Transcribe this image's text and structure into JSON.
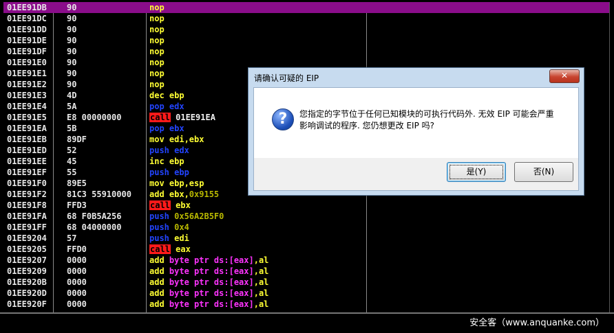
{
  "disassembly": {
    "rows": [
      {
        "addr": "01EE91DB",
        "hex": "90",
        "tokens": [
          {
            "t": "nop",
            "c": "yellow"
          }
        ],
        "selected": true
      },
      {
        "addr": "01EE91DC",
        "hex": "90",
        "tokens": [
          {
            "t": "nop",
            "c": "yellow"
          }
        ]
      },
      {
        "addr": "01EE91DD",
        "hex": "90",
        "tokens": [
          {
            "t": "nop",
            "c": "yellow"
          }
        ]
      },
      {
        "addr": "01EE91DE",
        "hex": "90",
        "tokens": [
          {
            "t": "nop",
            "c": "yellow"
          }
        ]
      },
      {
        "addr": "01EE91DF",
        "hex": "90",
        "tokens": [
          {
            "t": "nop",
            "c": "yellow"
          }
        ]
      },
      {
        "addr": "01EE91E0",
        "hex": "90",
        "tokens": [
          {
            "t": "nop",
            "c": "yellow"
          }
        ]
      },
      {
        "addr": "01EE91E1",
        "hex": "90",
        "tokens": [
          {
            "t": "nop",
            "c": "yellow"
          }
        ]
      },
      {
        "addr": "01EE91E2",
        "hex": "90",
        "tokens": [
          {
            "t": "nop",
            "c": "yellow"
          }
        ]
      },
      {
        "addr": "01EE91E3",
        "hex": "4D",
        "tokens": [
          {
            "t": "dec ebp",
            "c": "yellow"
          }
        ]
      },
      {
        "addr": "01EE91E4",
        "hex": "5A",
        "tokens": [
          {
            "t": "pop edx",
            "c": "blue"
          }
        ]
      },
      {
        "addr": "01EE91E5",
        "hex": "E8 00000000",
        "tokens": [
          {
            "t": "call",
            "c": "call"
          },
          {
            "t": " 01EE91EA",
            "c": "white"
          }
        ]
      },
      {
        "addr": "01EE91EA",
        "hex": "5B",
        "tokens": [
          {
            "t": "pop ebx",
            "c": "blue"
          }
        ]
      },
      {
        "addr": "01EE91EB",
        "hex": "89DF",
        "tokens": [
          {
            "t": "mov edi,ebx",
            "c": "yellow"
          }
        ]
      },
      {
        "addr": "01EE91ED",
        "hex": "52",
        "tokens": [
          {
            "t": "push edx",
            "c": "blue"
          }
        ]
      },
      {
        "addr": "01EE91EE",
        "hex": "45",
        "tokens": [
          {
            "t": "inc ebp",
            "c": "yellow"
          }
        ]
      },
      {
        "addr": "01EE91EF",
        "hex": "55",
        "tokens": [
          {
            "t": "push ebp",
            "c": "blue"
          }
        ]
      },
      {
        "addr": "01EE91F0",
        "hex": "89E5",
        "tokens": [
          {
            "t": "mov ebp,esp",
            "c": "yellow"
          }
        ]
      },
      {
        "addr": "01EE91F2",
        "hex": "81C3 55910000",
        "tokens": [
          {
            "t": "add ebx,",
            "c": "yellow"
          },
          {
            "t": "0x9155",
            "c": "olive"
          }
        ]
      },
      {
        "addr": "01EE91F8",
        "hex": "FFD3",
        "tokens": [
          {
            "t": "call",
            "c": "call"
          },
          {
            "t": " ebx",
            "c": "yellow"
          }
        ]
      },
      {
        "addr": "01EE91FA",
        "hex": "68 F0B5A256",
        "tokens": [
          {
            "t": "push",
            "c": "blue"
          },
          {
            "t": " 0x56A2B5F0",
            "c": "olive"
          }
        ]
      },
      {
        "addr": "01EE91FF",
        "hex": "68 04000000",
        "tokens": [
          {
            "t": "push",
            "c": "blue"
          },
          {
            "t": " 0x4",
            "c": "olive"
          }
        ]
      },
      {
        "addr": "01EE9204",
        "hex": "57",
        "tokens": [
          {
            "t": "push",
            "c": "blue"
          },
          {
            "t": " edi",
            "c": "yellow"
          }
        ]
      },
      {
        "addr": "01EE9205",
        "hex": "FFD0",
        "tokens": [
          {
            "t": "call",
            "c": "call"
          },
          {
            "t": " eax",
            "c": "yellow"
          }
        ]
      },
      {
        "addr": "01EE9207",
        "hex": "0000",
        "tokens": [
          {
            "t": "add ",
            "c": "yellow"
          },
          {
            "t": "byte ptr ds:[eax]",
            "c": "magenta"
          },
          {
            "t": ",al",
            "c": "yellow"
          }
        ]
      },
      {
        "addr": "01EE9209",
        "hex": "0000",
        "tokens": [
          {
            "t": "add ",
            "c": "yellow"
          },
          {
            "t": "byte ptr ds:[eax]",
            "c": "magenta"
          },
          {
            "t": ",al",
            "c": "yellow"
          }
        ]
      },
      {
        "addr": "01EE920B",
        "hex": "0000",
        "tokens": [
          {
            "t": "add ",
            "c": "yellow"
          },
          {
            "t": "byte ptr ds:[eax]",
            "c": "magenta"
          },
          {
            "t": ",al",
            "c": "yellow"
          }
        ]
      },
      {
        "addr": "01EE920D",
        "hex": "0000",
        "tokens": [
          {
            "t": "add ",
            "c": "yellow"
          },
          {
            "t": "byte ptr ds:[eax]",
            "c": "magenta"
          },
          {
            "t": ",al",
            "c": "yellow"
          }
        ]
      },
      {
        "addr": "01EE920F",
        "hex": "0000",
        "tokens": [
          {
            "t": "add ",
            "c": "yellow"
          },
          {
            "t": "byte ptr ds:[eax]",
            "c": "magenta"
          },
          {
            "t": ",al",
            "c": "yellow"
          }
        ]
      }
    ]
  },
  "dialog": {
    "title": "请确认可疑的 EIP",
    "close_label": "✕",
    "icon": "question-icon",
    "message_line1": "您指定的字节位于任何已知模块的可执行代码外. 无效 EIP 可能会严重",
    "message_line2": "影响调试的程序. 您仍想更改 EIP 吗?",
    "yes_label": "是(Y)",
    "no_label": "否(N)"
  },
  "footer": {
    "watermark": "安全客（www.anquanke.com）"
  },
  "colors": {
    "selected_row": "#8a0d8a",
    "call_bg": "#ff1a1a",
    "dialog_frame": "#c7dbef"
  }
}
